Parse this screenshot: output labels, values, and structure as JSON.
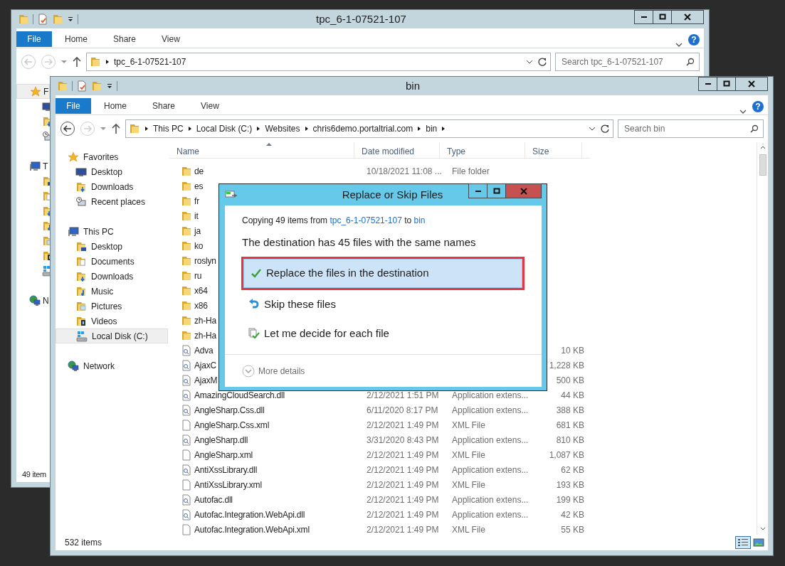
{
  "back_window": {
    "title": "tpc_6-1-07521-107",
    "ribbon": {
      "tabs": [
        {
          "label": "File",
          "kind": "file"
        },
        {
          "label": "Home",
          "kind": "tab"
        },
        {
          "label": "Share",
          "kind": "tab"
        },
        {
          "label": "View",
          "kind": "tab"
        }
      ],
      "help": "?"
    },
    "address": {
      "path": [
        "tpc_6-1-07521-107"
      ]
    },
    "search": {
      "placeholder": "Search tpc_6-1-07521-107"
    },
    "nav": [
      {
        "kind": "favorites",
        "label": "F",
        "selected": true,
        "children": [
          {
            "kind": "desktop",
            "selected": false
          },
          {
            "kind": "downloads",
            "selected": false
          },
          {
            "kind": "recent",
            "selected": false
          }
        ]
      },
      {
        "kind": "pc",
        "label": "T",
        "selected": false,
        "children": [
          {
            "kind": "desktop-folder",
            "selected": false
          },
          {
            "kind": "documents",
            "selected": false
          },
          {
            "kind": "downloads",
            "selected": false
          },
          {
            "kind": "music",
            "selected": false
          },
          {
            "kind": "pictures",
            "selected": false
          },
          {
            "kind": "videos",
            "selected": false
          },
          {
            "kind": "disk",
            "selected": false
          }
        ]
      },
      {
        "kind": "network",
        "label": "N",
        "selected": false
      }
    ],
    "status_bar": "49 item"
  },
  "front_window": {
    "title": "bin",
    "ribbon": {
      "tabs": [
        {
          "label": "File",
          "kind": "file"
        },
        {
          "label": "Home",
          "kind": "tab"
        },
        {
          "label": "Share",
          "kind": "tab"
        },
        {
          "label": "View",
          "kind": "tab"
        }
      ],
      "help": "?"
    },
    "address": {
      "path": [
        "This PC",
        "Local Disk (C:)",
        "Websites",
        "chris6demo.portaltrial.com",
        "bin"
      ]
    },
    "search": {
      "placeholder": "Search bin"
    },
    "nav": [
      {
        "kind": "favorites",
        "label": "Favorites",
        "selected": false,
        "children": [
          {
            "kind": "desktop",
            "label": "Desktop",
            "selected": false
          },
          {
            "kind": "downloads",
            "label": "Downloads",
            "selected": false
          },
          {
            "kind": "recent",
            "label": "Recent places",
            "selected": false
          }
        ]
      },
      {
        "kind": "pc",
        "label": "This PC",
        "selected": false,
        "children": [
          {
            "kind": "desktop-folder",
            "label": "Desktop",
            "selected": false
          },
          {
            "kind": "documents",
            "label": "Documents",
            "selected": false
          },
          {
            "kind": "downloads",
            "label": "Downloads",
            "selected": false
          },
          {
            "kind": "music",
            "label": "Music",
            "selected": false
          },
          {
            "kind": "pictures",
            "label": "Pictures",
            "selected": false
          },
          {
            "kind": "videos",
            "label": "Videos",
            "selected": false
          },
          {
            "kind": "disk",
            "label": "Local Disk (C:)",
            "selected": true
          }
        ]
      },
      {
        "kind": "network",
        "label": "Network",
        "selected": false
      }
    ],
    "table": {
      "columns": [
        "Name",
        "Date modified",
        "Type",
        "Size"
      ],
      "rows": [
        {
          "kind": "folder",
          "name": "de",
          "date": "10/18/2021 11:08 ...",
          "type": "File folder"
        },
        {
          "kind": "folder",
          "name": "es"
        },
        {
          "kind": "folder",
          "name": "fr"
        },
        {
          "kind": "folder",
          "name": "it"
        },
        {
          "kind": "folder",
          "name": "ja"
        },
        {
          "kind": "folder",
          "name": "ko"
        },
        {
          "kind": "folder",
          "name": "roslyn"
        },
        {
          "kind": "folder",
          "name": "ru"
        },
        {
          "kind": "folder",
          "name": "x64"
        },
        {
          "kind": "folder",
          "name": "x86"
        },
        {
          "kind": "folder",
          "name": "zh-Ha"
        },
        {
          "kind": "folder",
          "name": "zh-Ha"
        },
        {
          "kind": "dll",
          "name": "Adva",
          "size": "10 KB"
        },
        {
          "kind": "dll",
          "name": "AjaxC",
          "size": "1,228 KB"
        },
        {
          "kind": "dll",
          "name": "AjaxM",
          "size": "500 KB"
        },
        {
          "kind": "dll",
          "name": "AmazingCloudSearch.dll",
          "date": "2/12/2021 1:51 PM",
          "type": "Application extens...",
          "size": "44 KB"
        },
        {
          "kind": "dll",
          "name": "AngleSharp.Css.dll",
          "date": "6/11/2020 8:17 PM",
          "type": "Application extens...",
          "size": "388 KB"
        },
        {
          "kind": "xml",
          "name": "AngleSharp.Css.xml",
          "date": "2/12/2021 1:49 PM",
          "type": "XML File",
          "size": "681 KB"
        },
        {
          "kind": "dll",
          "name": "AngleSharp.dll",
          "date": "3/31/2020 8:43 PM",
          "type": "Application extens...",
          "size": "810 KB"
        },
        {
          "kind": "xml",
          "name": "AngleSharp.xml",
          "date": "2/12/2021 1:49 PM",
          "type": "XML File",
          "size": "1,087 KB"
        },
        {
          "kind": "dll",
          "name": "AntiXssLibrary.dll",
          "date": "2/12/2021 1:49 PM",
          "type": "Application extens...",
          "size": "62 KB"
        },
        {
          "kind": "xml",
          "name": "AntiXssLibrary.xml",
          "date": "2/12/2021 1:49 PM",
          "type": "XML File",
          "size": "193 KB"
        },
        {
          "kind": "dll",
          "name": "Autofac.dll",
          "date": "2/12/2021 1:49 PM",
          "type": "Application extens...",
          "size": "199 KB"
        },
        {
          "kind": "dll",
          "name": "Autofac.Integration.WebApi.dll",
          "date": "2/12/2021 1:49 PM",
          "type": "Application extens...",
          "size": "42 KB"
        },
        {
          "kind": "xml",
          "name": "Autofac.Integration.WebApi.xml",
          "date": "2/12/2021 1:49 PM",
          "type": "XML File",
          "size": "55 KB"
        }
      ]
    },
    "status_bar": "532 items",
    "views": [
      {
        "kind": "details",
        "selected": true
      },
      {
        "kind": "large",
        "selected": false
      }
    ]
  },
  "dialog": {
    "title": "Replace or Skip Files",
    "copying": {
      "before": "Copying 49 items from ",
      "source": "tpc_6-1-07521-107",
      "middle": " to ",
      "destination": "bin"
    },
    "heading": "The destination has 45 files with the same names",
    "options": [
      {
        "kind": "replace",
        "label": "Replace the files in the destination",
        "selected": true
      },
      {
        "kind": "skip",
        "label": "Skip these files",
        "selected": false
      },
      {
        "kind": "decide",
        "label": "Let me decide for each file",
        "selected": false
      }
    ],
    "more": "More details"
  }
}
